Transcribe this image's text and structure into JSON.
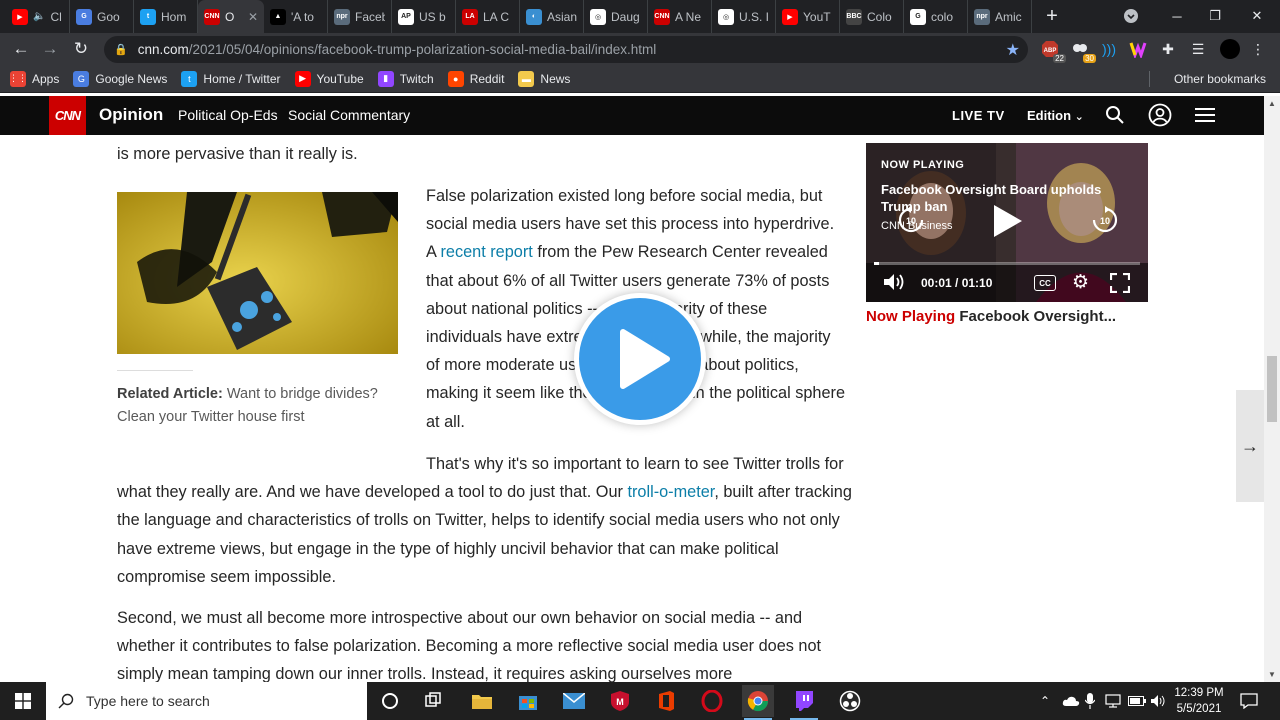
{
  "browser": {
    "tabs": [
      {
        "title": "Cl",
        "fav_color": "#ff0000",
        "fav_text": "▶",
        "muted": true
      },
      {
        "title": "Goo",
        "fav_color": "#4a7de0",
        "fav_text": "G"
      },
      {
        "title": "Hom",
        "fav_color": "#1da1f2",
        "fav_text": "t"
      },
      {
        "title": "O",
        "fav_color": "#cc0000",
        "fav_text": "CNN",
        "active": true
      },
      {
        "title": "'A to",
        "fav_color": "#000000",
        "fav_text": "▲"
      },
      {
        "title": "Faceb",
        "fav_color": "#5a6b7b",
        "fav_text": "npr"
      },
      {
        "title": "US b",
        "fav_color": "#ffffff",
        "fav_text": "AP"
      },
      {
        "title": "LA C",
        "fav_color": "#cc0000",
        "fav_text": "LA"
      },
      {
        "title": "Asian",
        "fav_color": "#3a8fd1",
        "fav_text": "◐"
      },
      {
        "title": "Daug",
        "fav_color": "#ffffff",
        "fav_text": "◎"
      },
      {
        "title": "A Ne",
        "fav_color": "#cc0000",
        "fav_text": "CNN"
      },
      {
        "title": "U.S. I",
        "fav_color": "#ffffff",
        "fav_text": "◎"
      },
      {
        "title": "YouT",
        "fav_color": "#ff0000",
        "fav_text": "▶"
      },
      {
        "title": "Colo",
        "fav_color": "#444444",
        "fav_text": "BBC"
      },
      {
        "title": "colo",
        "fav_color": "#ffffff",
        "fav_text": "G"
      },
      {
        "title": "Amic",
        "fav_color": "#5a6b7b",
        "fav_text": "npr"
      }
    ],
    "url_host": "cnn.com",
    "url_path": "/2021/05/04/opinions/facebook-trump-polarization-social-media-bail/index.html",
    "extension_badges": [
      "22",
      "30"
    ],
    "bookmarks": [
      {
        "label": "Apps",
        "color": "#ea4335",
        "icon": "⋮⋮"
      },
      {
        "label": "Google News",
        "color": "#4a7de0",
        "icon": "G"
      },
      {
        "label": "Home / Twitter",
        "color": "#1da1f2",
        "icon": "t"
      },
      {
        "label": "YouTube",
        "color": "#ff0000",
        "icon": "▶"
      },
      {
        "label": "Twitch",
        "color": "#9146ff",
        "icon": "▮"
      },
      {
        "label": "Reddit",
        "color": "#ff4500",
        "icon": "●"
      },
      {
        "label": "News",
        "color": "#f2c94c",
        "icon": "▬"
      }
    ],
    "other_bookmarks": "Other bookmarks"
  },
  "cnn": {
    "logo": "CNN",
    "section": "Opinion",
    "nav": [
      "Political Op-Eds",
      "Social Commentary"
    ],
    "live": "LIVE TV",
    "edition": "Edition"
  },
  "article": {
    "p0": "is more pervasive than it really is.",
    "p1_a": "False polarization existed long before social media, but social media users have set this process into hyperdrive. A ",
    "p1_link": "recent report",
    "p1_b": " from the Pew Research Center revealed that about 6% of all Twitter users generate 73% of posts about national politics -- and a majority of these individuals have extreme views. Meanwhile, the majority of more moderate users -- rarely post about politics, making it seem like they do not exist in the political sphere at all.",
    "p2_a": "That's why it's so important to learn to see Twitter trolls for what they really are. And we have developed a tool to do just that. Our ",
    "p2_link": "troll-o-meter",
    "p2_b": ", built after tracking the language and characteristics of trolls on Twitter, helps to identify social media users who not only have extreme views, but engage in the type of highly uncivil behavior that can make political compromise seem impossible.",
    "p3": "Second, we must all become more introspective about our own behavior on social media -- and whether it contributes to false polarization. Becoming a more reflective social media user does not simply mean tamping down our inner trolls. Instead, it requires asking ourselves more",
    "related_label": "Related Article:",
    "related_text": " Want to bridge divides? Clean your Twitter house first"
  },
  "video": {
    "now_playing": "NOW PLAYING",
    "title": "Facebook Oversight Board upholds Trump ban",
    "source": "CNN Business",
    "time": "00:01 / 01:10",
    "progress": 0.02,
    "cc": "CC",
    "caption_label": "Now Playing",
    "caption_title": "Facebook Oversight..."
  },
  "taskbar": {
    "search_placeholder": "Type here to search",
    "time": "12:39 PM",
    "date": "5/5/2021"
  }
}
